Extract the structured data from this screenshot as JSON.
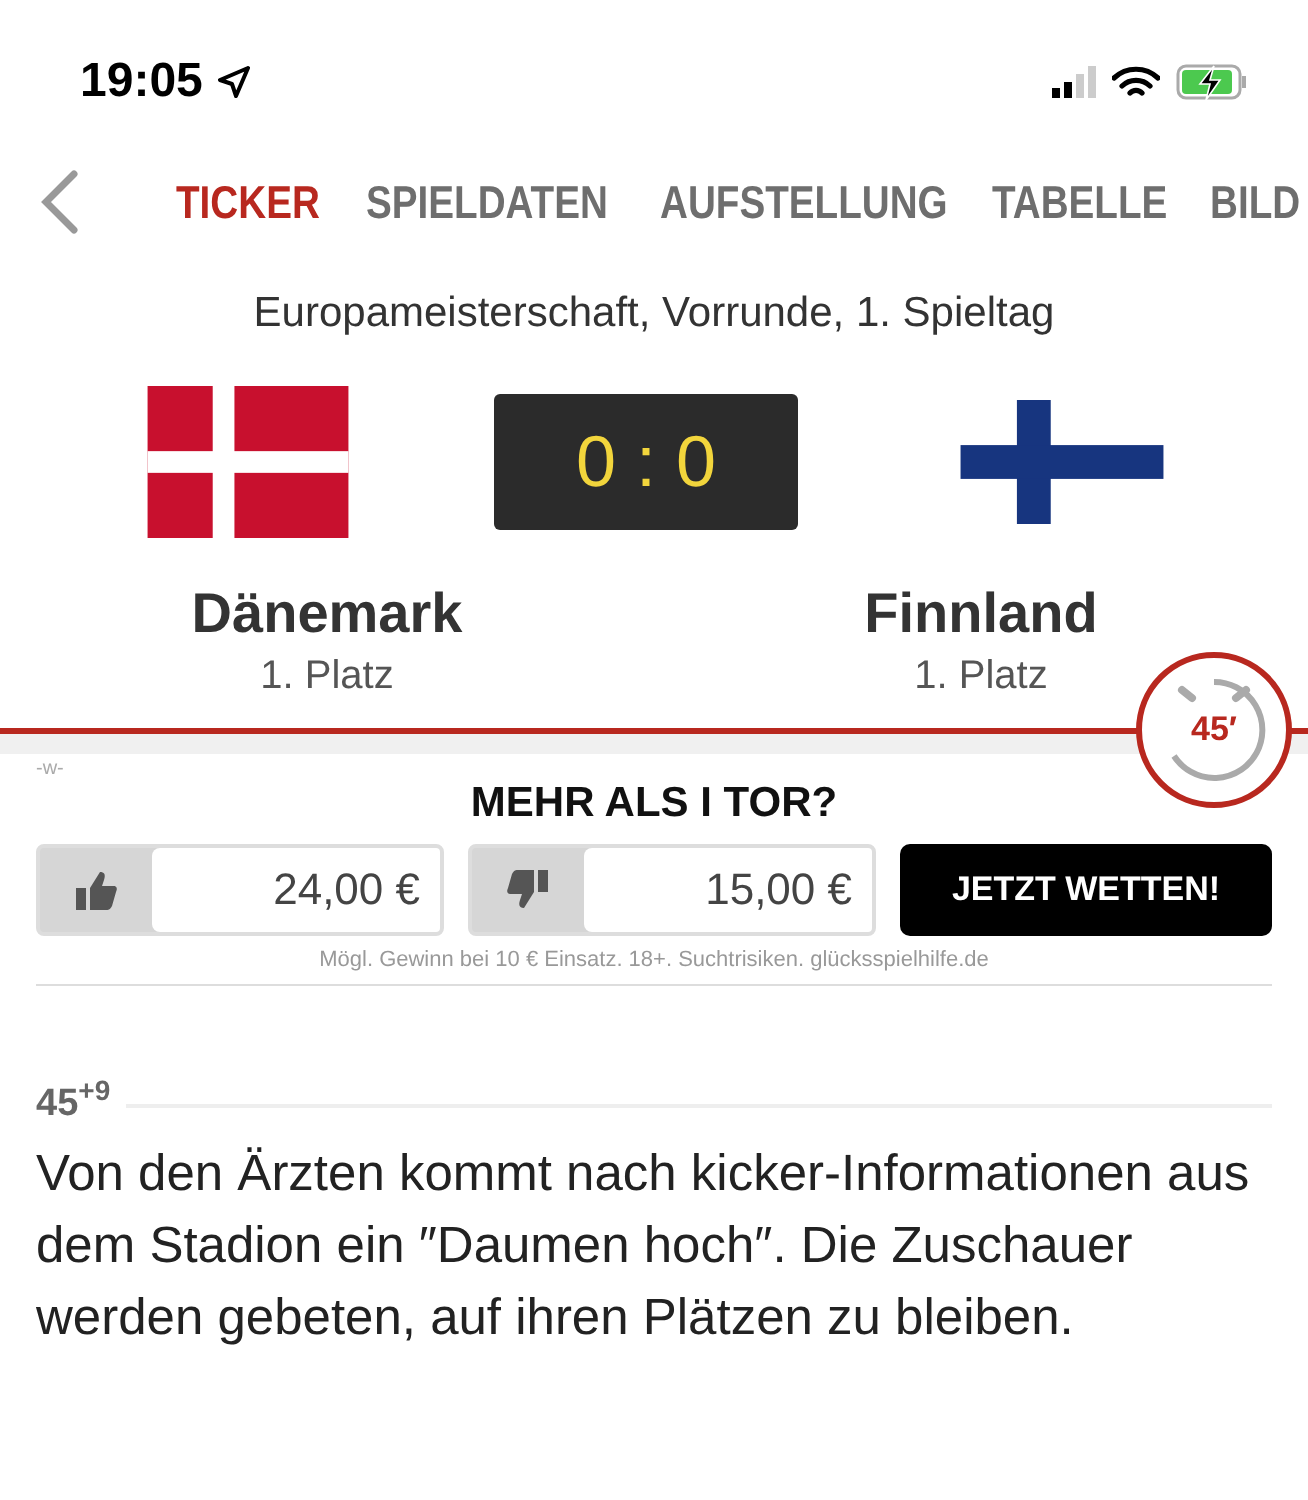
{
  "status_bar": {
    "time": "19:05"
  },
  "tabs": [
    {
      "label": "TICKER",
      "selected": true
    },
    {
      "label": "SPIELDATEN",
      "selected": false
    },
    {
      "label": "AUFSTELLUNG",
      "selected": false
    },
    {
      "label": "TABELLE",
      "selected": false
    },
    {
      "label": "BILD",
      "selected": false
    }
  ],
  "match": {
    "competition": "Europameisterschaft, Vorrunde, 1. Spieltag",
    "score": "0 : 0",
    "minute": "45′",
    "home": {
      "name": "Dänemark",
      "rank": "1. Platz",
      "kind": "denmark"
    },
    "away": {
      "name": "Finnland",
      "rank": "1. Platz",
      "kind": "finland"
    }
  },
  "bet": {
    "mark": "-w-",
    "question": "MEHR ALS I TOR?",
    "yes_odds": "24,00 €",
    "no_odds": "15,00 €",
    "button": "JETZT WETTEN!",
    "disclaimer": "Mögl. Gewinn bei 10 € Einsatz. 18+. Suchtrisiken. glücksspielhilfe.de"
  },
  "ticker": [
    {
      "minute": "45$^{+9}$",
      "text": "Von den Ärzten kommt nach kicker-Informationen aus dem Stadion ein ″Daumen hoch″. Die Zuschauer werden gebeten, auf ihren Plätzen zu bleiben."
    }
  ]
}
